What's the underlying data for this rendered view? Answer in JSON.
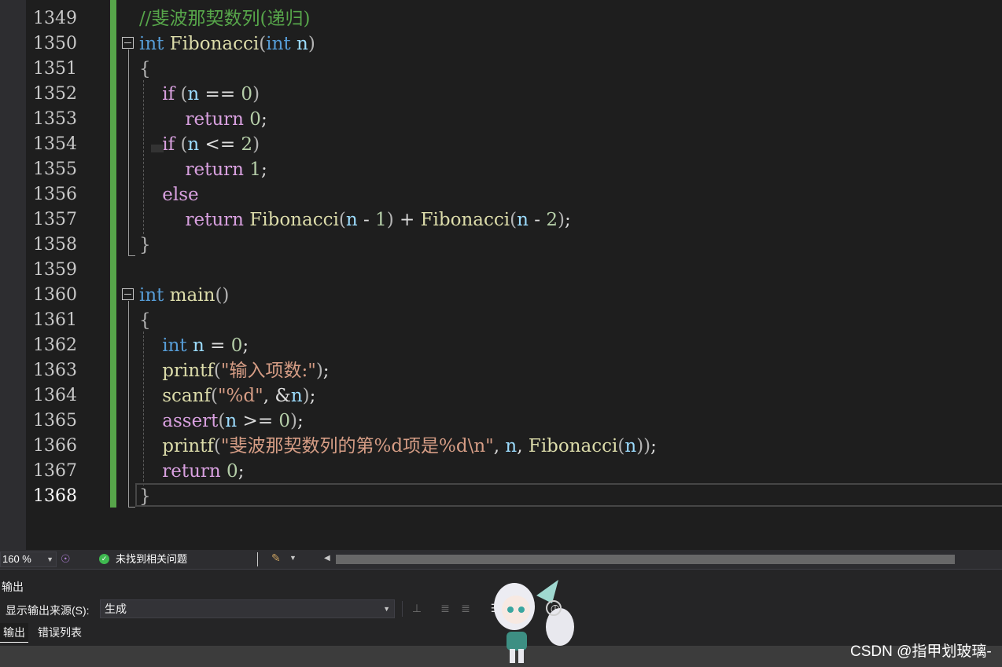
{
  "editor": {
    "lines": [
      {
        "n": "1349",
        "tokens": [
          {
            "c": "cmt",
            "t": "//斐波那契数列(递归)"
          }
        ]
      },
      {
        "n": "1350",
        "tokens": [
          {
            "c": "kw",
            "t": "int"
          },
          {
            "c": "",
            "t": " "
          },
          {
            "c": "fn",
            "t": "Fibonacci"
          },
          {
            "c": "punc",
            "t": "("
          },
          {
            "c": "kw",
            "t": "int"
          },
          {
            "c": "",
            "t": " "
          },
          {
            "c": "var",
            "t": "n"
          },
          {
            "c": "punc",
            "t": ")"
          }
        ]
      },
      {
        "n": "1351",
        "tokens": [
          {
            "c": "punc",
            "t": "{"
          }
        ]
      },
      {
        "n": "1352",
        "tokens": [
          {
            "c": "",
            "t": "    "
          },
          {
            "c": "ctl",
            "t": "if"
          },
          {
            "c": "",
            "t": " "
          },
          {
            "c": "punc",
            "t": "("
          },
          {
            "c": "var",
            "t": "n"
          },
          {
            "c": "",
            "t": " == "
          },
          {
            "c": "num",
            "t": "0"
          },
          {
            "c": "punc",
            "t": ")"
          }
        ]
      },
      {
        "n": "1353",
        "tokens": [
          {
            "c": "",
            "t": "        "
          },
          {
            "c": "ctl",
            "t": "return"
          },
          {
            "c": "",
            "t": " "
          },
          {
            "c": "num",
            "t": "0"
          },
          {
            "c": "",
            "t": ";"
          }
        ]
      },
      {
        "n": "1354",
        "tokens": [
          {
            "c": "",
            "t": "    "
          },
          {
            "c": "ctl",
            "t": "if"
          },
          {
            "c": "",
            "t": " "
          },
          {
            "c": "punc",
            "t": "("
          },
          {
            "c": "var",
            "t": "n"
          },
          {
            "c": "",
            "t": " <= "
          },
          {
            "c": "num",
            "t": "2"
          },
          {
            "c": "punc",
            "t": ")"
          }
        ]
      },
      {
        "n": "1355",
        "tokens": [
          {
            "c": "",
            "t": "        "
          },
          {
            "c": "ctl",
            "t": "return"
          },
          {
            "c": "",
            "t": " "
          },
          {
            "c": "num",
            "t": "1"
          },
          {
            "c": "",
            "t": ";"
          }
        ]
      },
      {
        "n": "1356",
        "tokens": [
          {
            "c": "",
            "t": "    "
          },
          {
            "c": "ctl",
            "t": "else"
          }
        ]
      },
      {
        "n": "1357",
        "tokens": [
          {
            "c": "",
            "t": "        "
          },
          {
            "c": "ctl",
            "t": "return"
          },
          {
            "c": "",
            "t": " "
          },
          {
            "c": "fn",
            "t": "Fibonacci"
          },
          {
            "c": "punc",
            "t": "("
          },
          {
            "c": "var",
            "t": "n"
          },
          {
            "c": "",
            "t": " - "
          },
          {
            "c": "num",
            "t": "1"
          },
          {
            "c": "punc",
            "t": ")"
          },
          {
            "c": "",
            "t": " + "
          },
          {
            "c": "fn",
            "t": "Fibonacci"
          },
          {
            "c": "punc",
            "t": "("
          },
          {
            "c": "var",
            "t": "n"
          },
          {
            "c": "",
            "t": " - "
          },
          {
            "c": "num",
            "t": "2"
          },
          {
            "c": "punc",
            "t": ")"
          },
          {
            "c": "",
            "t": ";"
          }
        ]
      },
      {
        "n": "1358",
        "tokens": [
          {
            "c": "punc",
            "t": "}"
          }
        ]
      },
      {
        "n": "1359",
        "tokens": []
      },
      {
        "n": "1360",
        "tokens": [
          {
            "c": "kw",
            "t": "int"
          },
          {
            "c": "",
            "t": " "
          },
          {
            "c": "fn",
            "t": "main"
          },
          {
            "c": "punc",
            "t": "()"
          }
        ]
      },
      {
        "n": "1361",
        "tokens": [
          {
            "c": "punc",
            "t": "{"
          }
        ]
      },
      {
        "n": "1362",
        "tokens": [
          {
            "c": "",
            "t": "    "
          },
          {
            "c": "kw",
            "t": "int"
          },
          {
            "c": "",
            "t": " "
          },
          {
            "c": "var",
            "t": "n"
          },
          {
            "c": "",
            "t": " = "
          },
          {
            "c": "num",
            "t": "0"
          },
          {
            "c": "",
            "t": ";"
          }
        ]
      },
      {
        "n": "1363",
        "tokens": [
          {
            "c": "",
            "t": "    "
          },
          {
            "c": "fn",
            "t": "printf"
          },
          {
            "c": "punc",
            "t": "("
          },
          {
            "c": "str",
            "t": "\"输入项数:\""
          },
          {
            "c": "punc",
            "t": ")"
          },
          {
            "c": "",
            "t": ";"
          }
        ]
      },
      {
        "n": "1364",
        "tokens": [
          {
            "c": "",
            "t": "    "
          },
          {
            "c": "fn",
            "t": "scanf"
          },
          {
            "c": "punc",
            "t": "("
          },
          {
            "c": "str",
            "t": "\"%d\""
          },
          {
            "c": "",
            "t": ", &"
          },
          {
            "c": "var",
            "t": "n"
          },
          {
            "c": "punc",
            "t": ")"
          },
          {
            "c": "",
            "t": ";"
          }
        ]
      },
      {
        "n": "1365",
        "tokens": [
          {
            "c": "",
            "t": "    "
          },
          {
            "c": "ctl",
            "t": "assert"
          },
          {
            "c": "punc",
            "t": "("
          },
          {
            "c": "var",
            "t": "n"
          },
          {
            "c": "",
            "t": " >= "
          },
          {
            "c": "num",
            "t": "0"
          },
          {
            "c": "punc",
            "t": ")"
          },
          {
            "c": "",
            "t": ";"
          }
        ]
      },
      {
        "n": "1366",
        "tokens": [
          {
            "c": "",
            "t": "    "
          },
          {
            "c": "fn",
            "t": "printf"
          },
          {
            "c": "punc",
            "t": "("
          },
          {
            "c": "str",
            "t": "\"斐波那契数列的第%d项是%d\\n\""
          },
          {
            "c": "",
            "t": ", "
          },
          {
            "c": "var",
            "t": "n"
          },
          {
            "c": "",
            "t": ", "
          },
          {
            "c": "fn",
            "t": "Fibonacci"
          },
          {
            "c": "punc",
            "t": "("
          },
          {
            "c": "var",
            "t": "n"
          },
          {
            "c": "punc",
            "t": "))"
          },
          {
            "c": "",
            "t": ";"
          }
        ]
      },
      {
        "n": "1367",
        "tokens": [
          {
            "c": "",
            "t": "    "
          },
          {
            "c": "ctl",
            "t": "return"
          },
          {
            "c": "",
            "t": " "
          },
          {
            "c": "num",
            "t": "0"
          },
          {
            "c": "",
            "t": ";"
          }
        ]
      },
      {
        "n": "1368",
        "tokens": [
          {
            "c": "punc",
            "t": "}"
          }
        ]
      }
    ]
  },
  "status": {
    "zoom": "160 %",
    "issues": "未找到相关问题"
  },
  "output": {
    "title": "输出",
    "source_label": "显示输出来源(S):",
    "source_value": "生成",
    "tabs": [
      "输出",
      "错误列表"
    ]
  },
  "watermark": "CSDN @指甲划玻璃-",
  "icons": {
    "ok": "check-circle-icon",
    "brush": "code-cleanup-brush-icon"
  }
}
